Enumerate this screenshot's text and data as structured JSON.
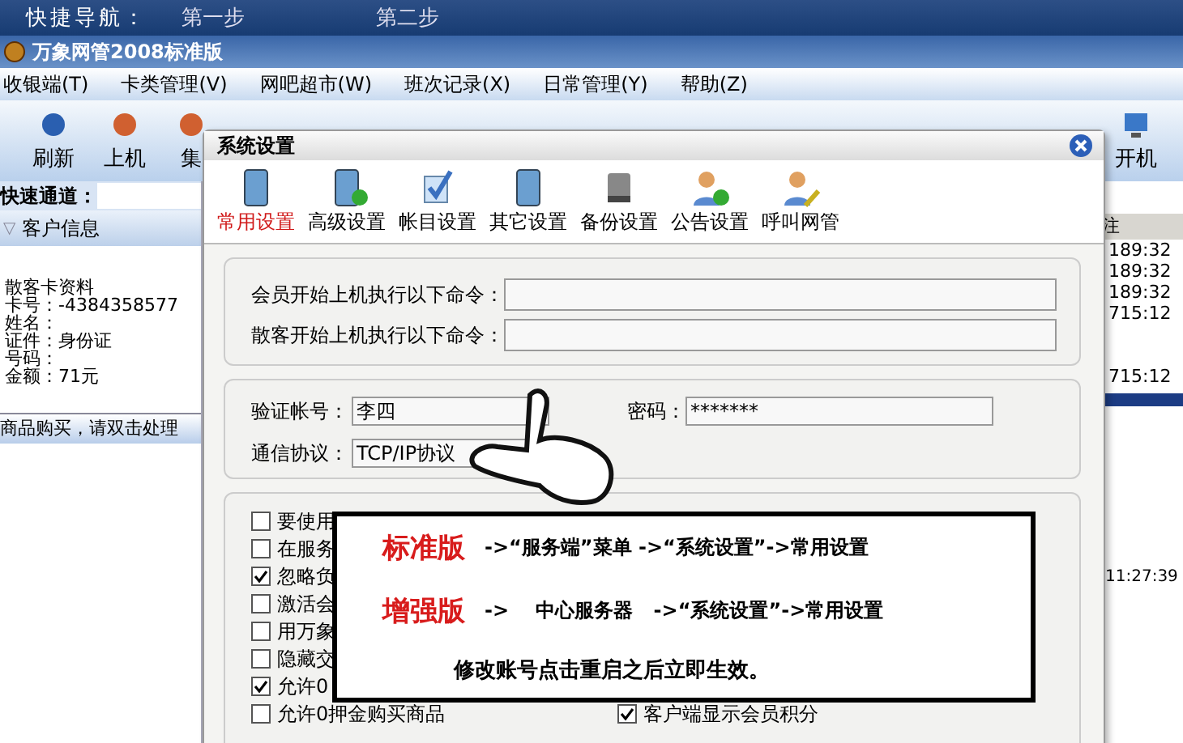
{
  "nav": {
    "label": "快捷导航：",
    "steps": [
      "第一步",
      "第二步"
    ]
  },
  "app": {
    "title": "万象网管2008标准版"
  },
  "menu": [
    "收银端(T)",
    "卡类管理(V)",
    "网吧超市(W)",
    "班次记录(X)",
    "日常管理(Y)",
    "帮助(Z)"
  ],
  "toolbar": [
    {
      "label": "刷新",
      "kind": "left"
    },
    {
      "label": "上机",
      "kind": "left"
    },
    {
      "label": "集",
      "kind": "left"
    },
    {
      "label": "开机",
      "kind": "right"
    }
  ],
  "quick_channel": {
    "label": "快速通道："
  },
  "customer_panel": {
    "toggle": "▽",
    "title": "客户信息",
    "lines": [
      "散客卡资料",
      "卡号：-4384358577",
      "姓名：",
      "证件：身份证",
      "号码：",
      "金额：71元"
    ],
    "notice": "商品购买，请双击处理"
  },
  "right_table": {
    "header": "注",
    "rows": [
      "189:32",
      "189:32",
      "189:32",
      "715:12",
      "",
      "",
      "715:12"
    ],
    "times": [
      "11:27:39"
    ]
  },
  "dialog": {
    "title": "系统设置",
    "tabs": [
      {
        "label": "常用设置",
        "selected": true,
        "kind": "server"
      },
      {
        "label": "高级设置",
        "selected": false,
        "kind": "server-add"
      },
      {
        "label": "帐目设置",
        "selected": false,
        "kind": "check"
      },
      {
        "label": "其它设置",
        "selected": false,
        "kind": "server"
      },
      {
        "label": "备份设置",
        "selected": false,
        "kind": "disk"
      },
      {
        "label": "公告设置",
        "selected": false,
        "kind": "user-add"
      },
      {
        "label": "呼叫网管",
        "selected": false,
        "kind": "user-pen"
      }
    ],
    "commands": [
      {
        "label": "会员开始上机执行以下命令："
      },
      {
        "label": "散客开始上机执行以下命令："
      }
    ],
    "account": {
      "label": "验证帐号：",
      "value": "李四"
    },
    "password": {
      "label": "密码：",
      "value": "*******"
    },
    "protocol": {
      "label": "通信协议：",
      "value": "TCP/IP协议"
    },
    "options": [
      {
        "label": "要使用",
        "checked": false
      },
      {
        "label": "在服务",
        "checked": false
      },
      {
        "label": "忽略负",
        "checked": true
      },
      {
        "label": "激活会",
        "checked": false
      },
      {
        "label": "用万象",
        "checked": false
      },
      {
        "label": "隐藏交",
        "checked": false
      },
      {
        "label": "允许0",
        "checked": true
      },
      {
        "label": "允许0押金购买商品",
        "checked": false
      }
    ],
    "options_right": [
      {
        "label": "客户端显示会员积分",
        "checked": true
      }
    ]
  },
  "callout": {
    "rows": [
      {
        "edition": "标准版",
        "path": "->“服务端”菜单 ->“系统设置”->常用设置"
      },
      {
        "edition": "增强版",
        "path": "->    中心服务器   ->“系统设置”->常用设置"
      }
    ],
    "note": "修改账号点击重启之后立即生效。"
  }
}
